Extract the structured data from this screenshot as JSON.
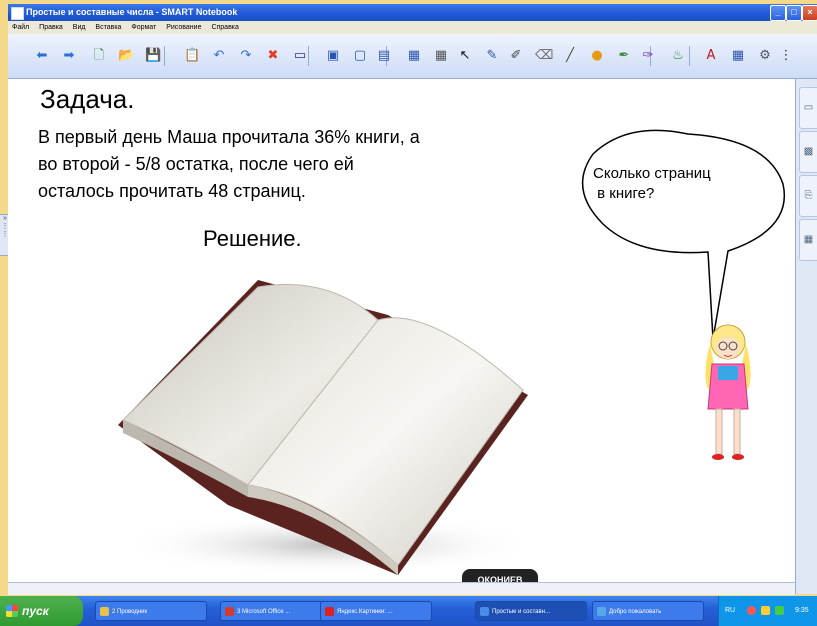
{
  "window": {
    "title": "Простые и составные числа - SMART Notebook",
    "min_label": "_",
    "max_label": "□",
    "close_label": "×"
  },
  "menu": [
    "Файл",
    "Правка",
    "Вид",
    "Вставка",
    "Формат",
    "Рисование",
    "Справка"
  ],
  "toolbar_icons": [
    {
      "name": "back-arrow-icon",
      "glyph": "⬅",
      "color": "#2b6fd6"
    },
    {
      "name": "forward-arrow-icon",
      "glyph": "➡",
      "color": "#2b6fd6"
    },
    {
      "name": "add-page-icon",
      "glyph": "🗋",
      "color": "#2e8a2e"
    },
    {
      "name": "open-folder-icon",
      "glyph": "📂",
      "color": "#d9a320"
    },
    {
      "name": "save-icon",
      "glyph": "💾",
      "color": "#2b56b0"
    },
    {
      "name": "paste-icon",
      "glyph": "📋",
      "color": "#556"
    },
    {
      "name": "undo-icon",
      "glyph": "↶",
      "color": "#3a6fd0"
    },
    {
      "name": "redo-icon",
      "glyph": "↷",
      "color": "#3a6fd0"
    },
    {
      "name": "delete-icon",
      "glyph": "✖",
      "color": "#e23b2b"
    },
    {
      "name": "screen-shade-icon",
      "glyph": "▭",
      "color": "#336"
    },
    {
      "name": "full-screen-icon",
      "glyph": "▣",
      "color": "#2b56b0"
    },
    {
      "name": "display-icon",
      "glyph": "▢",
      "color": "#2b56b0"
    },
    {
      "name": "capture-icon",
      "glyph": "▤",
      "color": "#2b56b0"
    },
    {
      "name": "document-camera-icon",
      "glyph": "▦",
      "color": "#2b56b0"
    },
    {
      "name": "table-icon",
      "glyph": "▦",
      "color": "#555"
    },
    {
      "name": "select-pointer-icon",
      "glyph": "↖",
      "color": "#111"
    },
    {
      "name": "pen-icon",
      "glyph": "✎",
      "color": "#2b56b0"
    },
    {
      "name": "creative-pen-icon",
      "glyph": "✐",
      "color": "#444"
    },
    {
      "name": "eraser-icon",
      "glyph": "⌫",
      "color": "#666"
    },
    {
      "name": "line-icon",
      "glyph": "╱",
      "color": "#444"
    },
    {
      "name": "shapes-icon",
      "glyph": "●",
      "color": "#e59a1a"
    },
    {
      "name": "magic-pen-icon",
      "glyph": "✒",
      "color": "#3a8a3a"
    },
    {
      "name": "shape-recognition-pen-icon",
      "glyph": "✑",
      "color": "#7a3ab0"
    },
    {
      "name": "fill-icon",
      "glyph": "♨",
      "color": "#2b8a2b"
    },
    {
      "name": "text-icon",
      "glyph": "A",
      "color": "#c0161c"
    },
    {
      "name": "properties-icon",
      "glyph": "▦",
      "color": "#2b56b0"
    },
    {
      "name": "toolbar-options-icon",
      "glyph": "⚙",
      "color": "#556"
    },
    {
      "name": "more-tools-icon",
      "glyph": "⋮",
      "color": "#333"
    }
  ],
  "slide": {
    "heading": "Задача.",
    "problem_lines": [
      "В первый день Маша прочитала 36% книги, а",
      "во второй - 5/8 остатка, после чего ей",
      "осталось прочитать 48 страниц."
    ],
    "solution_label": "Решение.",
    "bubble_lines": [
      "Сколько страниц",
      " в книге?"
    ],
    "watermark": "ОКОНИЕВ"
  },
  "side_tabs": [
    "page-sorter-icon",
    "gallery-icon",
    "attachments-icon",
    "properties-tab-icon"
  ],
  "taskbar": {
    "start_label": "пуск",
    "tasks": [
      {
        "label": "2 Проводник",
        "color": "#e8c04a",
        "active": false
      },
      {
        "label": "3 Microsoft Office ...",
        "color": "#d33c2c",
        "active": false
      },
      {
        "label": "Яндекс.Картинки: ...",
        "color": "#e02020",
        "active": false
      },
      {
        "label": "Простые и составн...",
        "color": "#4a8be8",
        "active": true
      },
      {
        "label": "Добро пожаловать",
        "color": "#56a8e8",
        "active": false
      }
    ],
    "tray_lang": "RU",
    "tray_time": "9:35"
  }
}
